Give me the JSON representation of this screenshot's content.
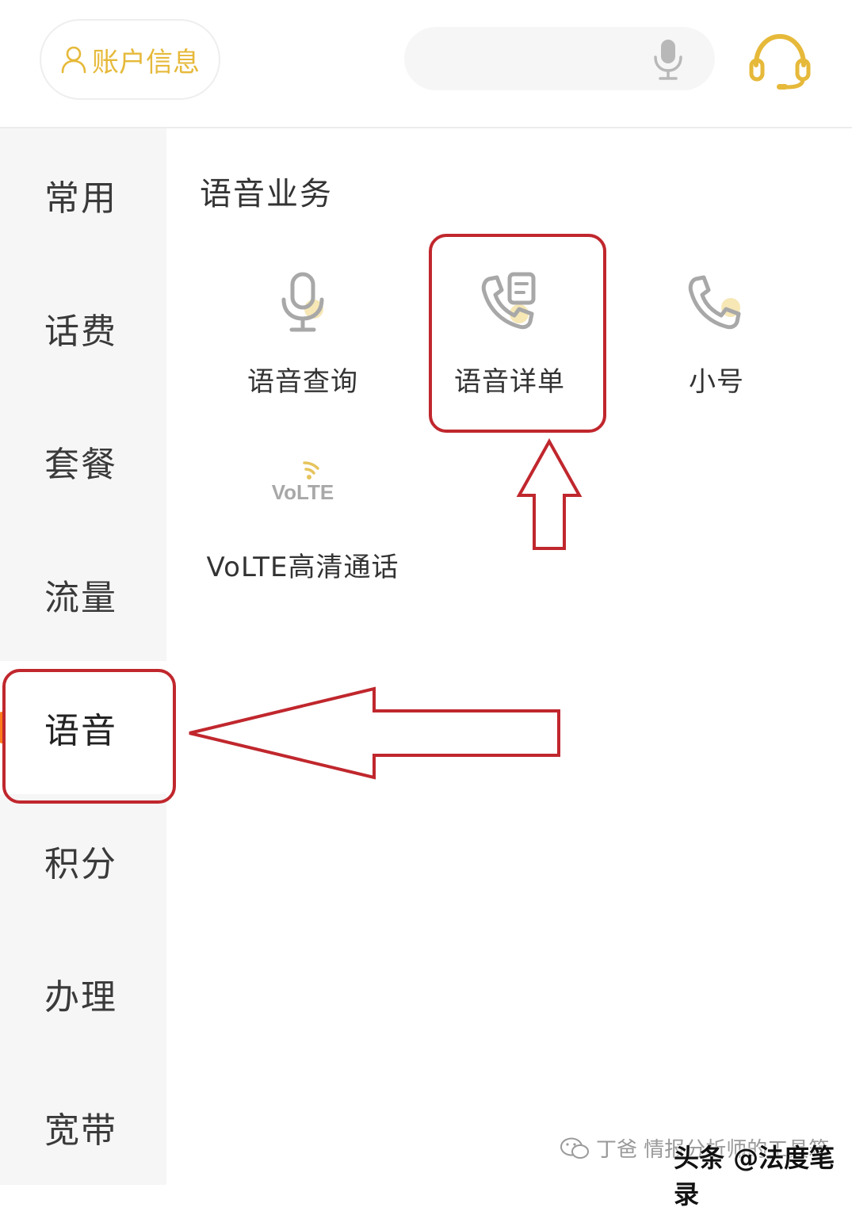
{
  "header": {
    "account_label": "账户信息",
    "search_placeholder": ""
  },
  "sidebar": {
    "items": [
      {
        "label": "常用"
      },
      {
        "label": "话费"
      },
      {
        "label": "套餐"
      },
      {
        "label": "流量"
      },
      {
        "label": "语音",
        "active": true
      },
      {
        "label": "积分"
      },
      {
        "label": "办理"
      },
      {
        "label": "宽带"
      }
    ]
  },
  "main": {
    "section_title": "语音业务",
    "services": [
      {
        "label": "语音查询",
        "icon": "microphone-icon"
      },
      {
        "label": "语音详单",
        "icon": "phone-detail-icon"
      },
      {
        "label": "小号",
        "icon": "phone-icon"
      },
      {
        "label": "VoLTE高清通话",
        "icon": "volte-icon",
        "icon_text": "VoLTE"
      }
    ]
  },
  "watermark": {
    "source": "丁爸 情报分析师的工具箱",
    "brand": "头条 @法度笔录"
  },
  "colors": {
    "accent": "#e6b93a",
    "active_marker": "#ff7a1a",
    "annotation_red": "#c0272d",
    "sidebar_bg": "#f6f6f6"
  }
}
